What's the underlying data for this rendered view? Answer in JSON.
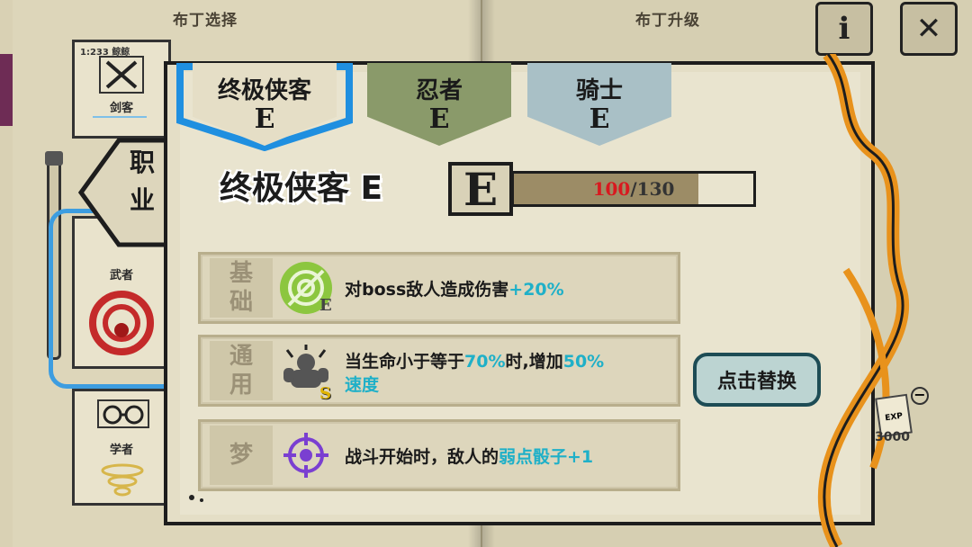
{
  "header": {
    "left_title": "布丁选择",
    "right_title": "布丁升级",
    "info_icon": "i",
    "close_icon": "✕"
  },
  "sidebar": {
    "arrow_label": "职业",
    "items": [
      {
        "label": "剑客",
        "icon": "crossed-swords-icon"
      },
      {
        "label": "武者",
        "icon": "martial-artist-icon"
      },
      {
        "label": "学者",
        "icon": "scholar-glasses-icon"
      }
    ],
    "top_card_text": "1:233 鲸鲸"
  },
  "tabs": [
    {
      "name": "终极侠客",
      "grade": "E",
      "selected": true
    },
    {
      "name": "忍者",
      "grade": "E",
      "selected": false
    },
    {
      "name": "骑士",
      "grade": "E",
      "selected": false
    }
  ],
  "character": {
    "title": "终极侠客 E",
    "grade": "E",
    "xp_current": "100",
    "xp_sep": "/",
    "xp_max": "130",
    "xp_fraction": 0.77
  },
  "skills": [
    {
      "tag1": "基",
      "tag2": "础",
      "icon": "target-crosshair-icon",
      "grade": "E",
      "desc_parts": [
        "对boss敌人造成伤害",
        "+20%"
      ]
    },
    {
      "tag1": "通",
      "tag2": "用",
      "icon": "muscle-gorilla-icon",
      "grade": "S",
      "desc_line1_parts": [
        "当生命小于等于",
        "70%",
        "时,增加",
        "50%"
      ],
      "desc_line2": "速度"
    },
    {
      "tag1": "梦",
      "tag2": "",
      "icon": "purple-crosshair-icon",
      "desc_parts": [
        "战斗开始时，敌人的",
        "弱点骰子+1"
      ]
    }
  ],
  "replace_button": "点击替换",
  "right_deco": {
    "exp_label": "EXP",
    "exp_value": "3000"
  },
  "colors": {
    "highlight": "#1fb0c8",
    "xp_current": "#d8191f",
    "selected_tab_border": "#1f8fe0",
    "tab1": "#e5dec6",
    "tab2": "#8a9a6a",
    "tab3": "#a9c0c6"
  }
}
